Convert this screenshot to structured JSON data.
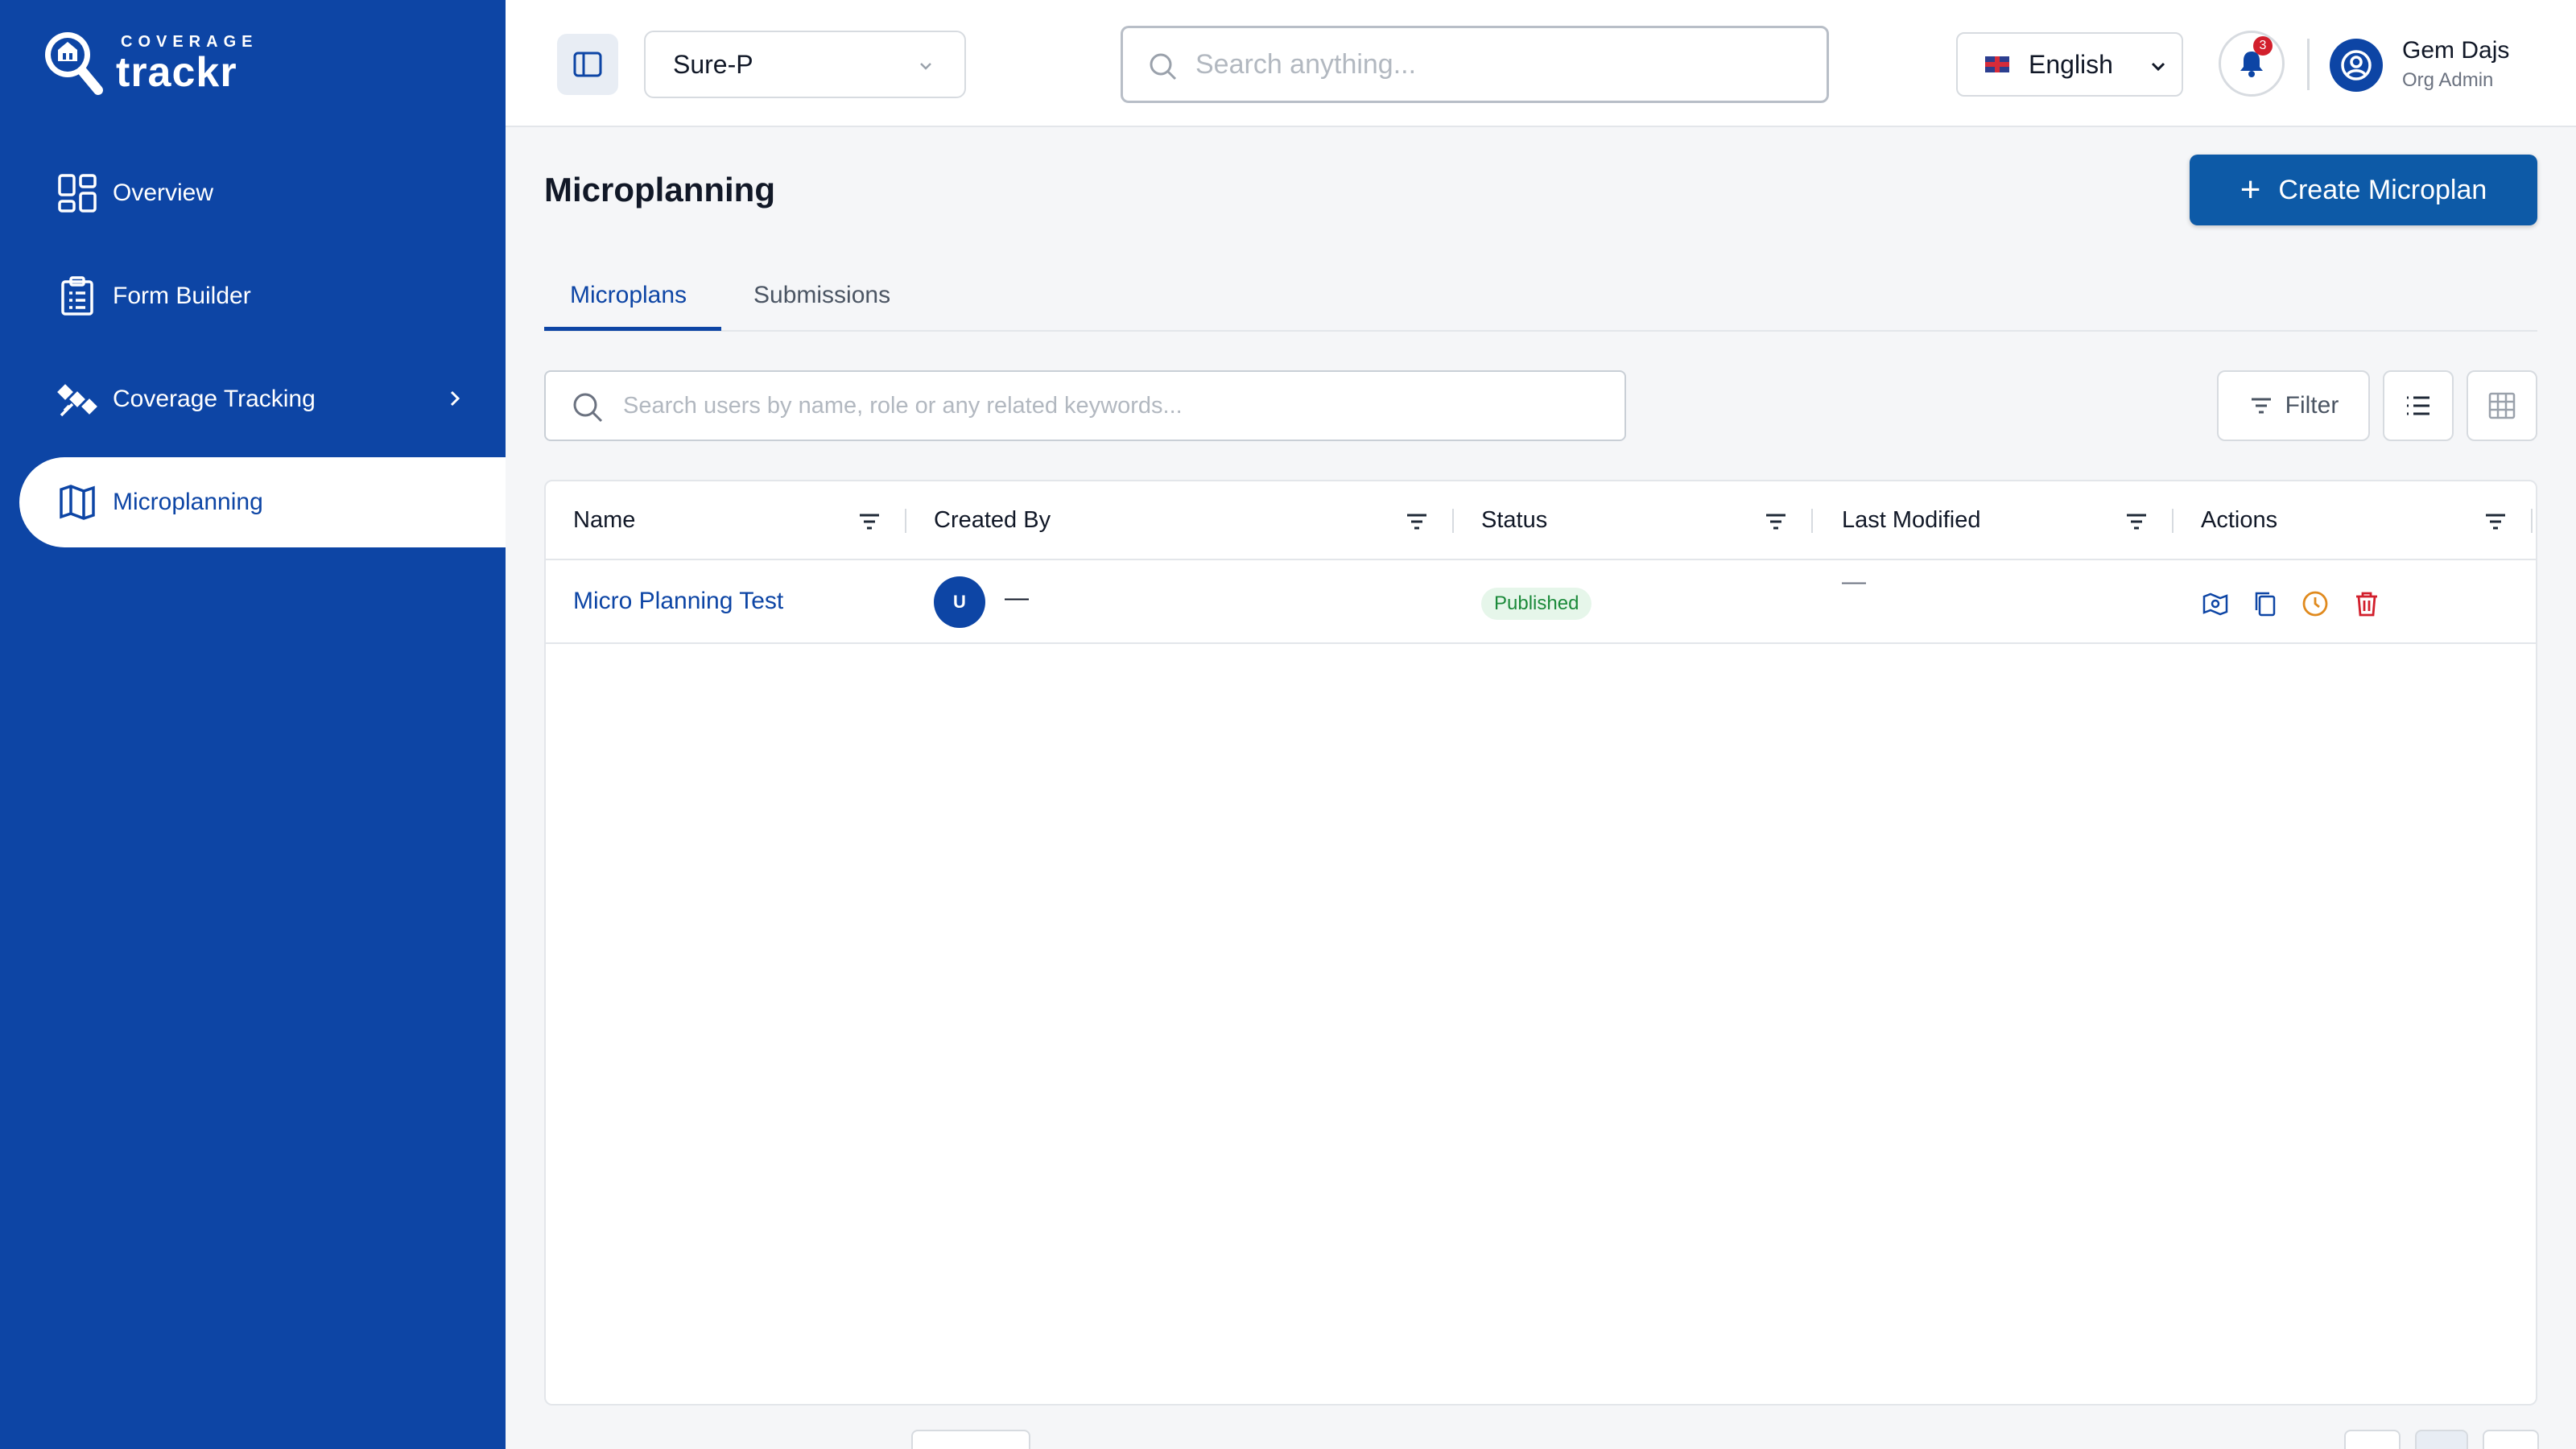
{
  "brand": {
    "top": "COVERAGE",
    "main": "trackr"
  },
  "sidebar": {
    "items": [
      {
        "label": "Overview",
        "icon": "grid-icon"
      },
      {
        "label": "Form Builder",
        "icon": "clipboard-icon"
      },
      {
        "label": "Coverage Tracking",
        "icon": "satellite-icon"
      },
      {
        "label": "Microplanning",
        "icon": "map-icon",
        "active": true
      }
    ]
  },
  "header": {
    "org_selected": "Sure-P",
    "search_placeholder": "Search anything...",
    "language": "English",
    "notifications_count": "3",
    "user_name": "Gem Dajs",
    "user_role": "Org Admin"
  },
  "main": {
    "title": "Microplanning",
    "create_label": "Create Microplan",
    "tabs": [
      {
        "label": "Microplans",
        "active": true
      },
      {
        "label": "Submissions"
      }
    ],
    "search_placeholder": "Search users by name, role or any related keywords...",
    "filter_label": "Filter"
  },
  "table": {
    "columns": [
      "Name",
      "Created By",
      "Status",
      "Last Modified",
      "Actions"
    ],
    "rows": [
      {
        "name": "Micro Planning Test",
        "created_by_initial": "U",
        "created_by": "—",
        "status": "Published",
        "last_modified": "—",
        "actions": [
          "map-icon",
          "copy-icon",
          "clock-icon",
          "trash-icon"
        ]
      }
    ]
  },
  "colors": {
    "brand": "#0d45a5",
    "button": "#0d5aa7",
    "status_published_bg": "#e6f6ea",
    "status_published_text": "#1b8a3a",
    "clock": "#e08a1e",
    "danger": "#d21f2c"
  }
}
